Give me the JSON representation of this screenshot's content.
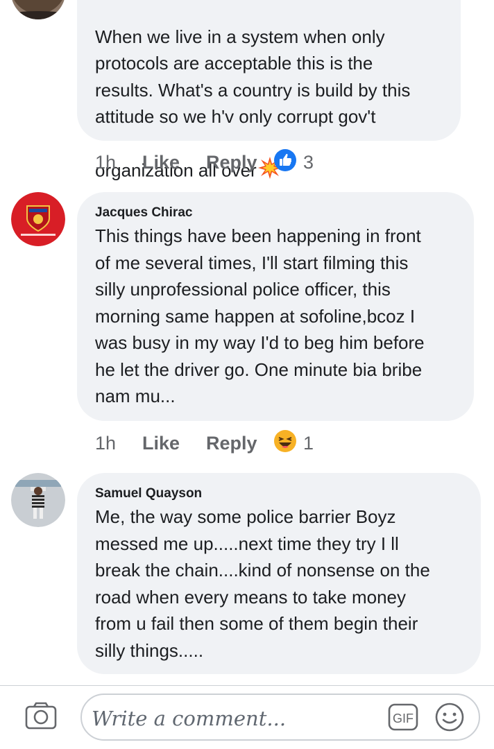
{
  "comments": [
    {
      "author": "",
      "text": "When we live in a system when only\nprotocols are acceptable this is the\nresults. What's a country is build by this\nattitude so we h'v only corrupt gov't\norganization all over",
      "time": "1h",
      "like_label": "Like",
      "reply_label": "Reply",
      "reaction": "like-icon",
      "reaction_count": "3",
      "reaction_color": "#1877f2"
    },
    {
      "author": "Jacques Chirac",
      "text": "This things have been happening in front\nof me several times, I'll start filming this\nsilly unprofessional police officer, this\nmorning same happen at sofoline,bcoz I\nwas busy in my way I'd to beg him before\nhe let the driver go. One minute bia bribe\nnam mu...",
      "time": "1h",
      "like_label": "Like",
      "reply_label": "Reply",
      "reaction": "haha-icon",
      "reaction_count": "1"
    },
    {
      "author": "Samuel Quayson",
      "text": "Me, the way some police barrier Boyz\nmessed me up.....next time they try I ll\nbreak the chain....kind of nonsense on the\nroad when every means to take money\nfrom u fail then some of them begin their\nsilly things....."
    }
  ],
  "composer": {
    "placeholder": "Write a comment...",
    "gif_label": "GIF",
    "camera_icon": "camera-icon",
    "emoji_icon": "emoji-icon"
  },
  "colors": {
    "bubble": "#f0f2f5",
    "meta": "#65676b",
    "like_blue": "#1877f2"
  }
}
